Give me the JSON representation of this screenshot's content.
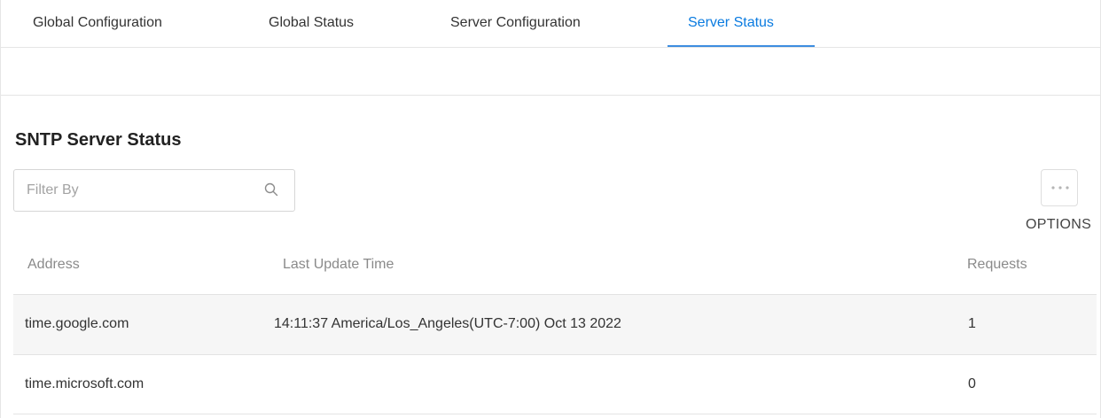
{
  "tabs": [
    {
      "label": "Global Configuration",
      "active": false
    },
    {
      "label": "Global Status",
      "active": false
    },
    {
      "label": "Server Configuration",
      "active": false
    },
    {
      "label": "Server Status",
      "active": true
    }
  ],
  "accent_color": "#0a7be0",
  "section": {
    "title": "SNTP Server Status"
  },
  "filter": {
    "placeholder": "Filter By",
    "value": "",
    "icon": "search-icon"
  },
  "options": {
    "label": "OPTIONS",
    "icon": "more-dots-icon"
  },
  "table": {
    "columns": [
      "Address",
      "Last Update Time",
      "Requests"
    ],
    "rows": [
      {
        "address": "time.google.com",
        "last_update": "14:11:37 America/Los_Angeles(UTC-7:00) Oct 13 2022",
        "requests": "1"
      },
      {
        "address": "time.microsoft.com",
        "last_update": "",
        "requests": "0"
      }
    ]
  }
}
